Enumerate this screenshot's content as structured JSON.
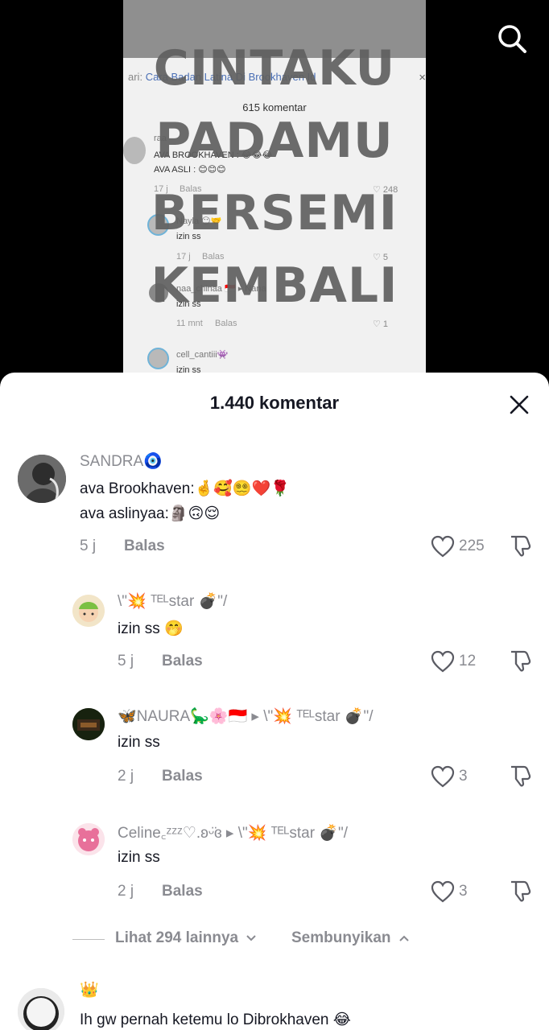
{
  "video": {
    "overlay_lines": [
      "CINTAKU",
      "PADAMU",
      "BERSEMI",
      "KEMBALI"
    ],
    "embedded": {
      "search_prefix": "ari:",
      "search_query": "Cara Badan Latina Di Brookhaven Id",
      "search_close": "×",
      "count": "615 komentar",
      "comments": [
        {
          "user": "raa",
          "lines": [
            "AVA BROOKHAVEN : 😂😂😂",
            "AVA ASLI : 😊😊😊"
          ],
          "time": "17 j",
          "reply": "Balas",
          "likes": "248"
        },
        {
          "user": "Nayla 😶🤝",
          "lines": [
            "izin ss"
          ],
          "time": "17 j",
          "reply": "Balas",
          "likes": "5"
        },
        {
          "user": "naa_chinaa 🇮🇩 ▸ Nana",
          "lines": [
            "izin ss"
          ],
          "time": "11 mnt",
          "reply": "Balas",
          "likes": "1"
        },
        {
          "user": "cell_cantiii👾",
          "lines": [
            "izin ss"
          ]
        }
      ]
    }
  },
  "sheet": {
    "title": "1.440 komentar",
    "comments": [
      {
        "user": "SANDRA🧿",
        "lines": [
          "ava Brookhaven:🤞🥰😵‍💫❤️🌹",
          "ava aslinyaa:🗿🙃😌"
        ],
        "time": "5 j",
        "reply": "Balas",
        "likes": "225"
      },
      {
        "user": "\\\"💥 ᵀᴱᴸstar 💣\"/",
        "lines": [
          "izin ss 🤭"
        ],
        "time": "5 j",
        "reply": "Balas",
        "likes": "12"
      },
      {
        "user": "🦋NAURA🦕🌸🇮🇩 ▸ \\\"💥 ᵀᴱᴸstar 💣\"/",
        "lines": [
          "izin ss"
        ],
        "time": "2 j",
        "reply": "Balas",
        "likes": "3"
      },
      {
        "user": "Celine꜀ᶻᶻᶻ♡.ʚᵕ̈ɞ ▸ \\\"💥 ᵀᴱᴸstar 💣\"/",
        "lines": [
          "izin ss"
        ],
        "time": "2 j",
        "reply": "Balas",
        "likes": "3"
      },
      {
        "user": "👑",
        "lines": [
          "Ih gw pernah ketemu lo Dibrokhaven 😂"
        ]
      }
    ],
    "view_more": "Lihat 294 lainnya",
    "hide": "Sembunyikan"
  },
  "colors": {
    "accent_gray": "#8a8b91",
    "text": "#161823",
    "sheet_bg": "#ffffff",
    "video_bg": "#000000"
  },
  "icons": [
    "search-icon",
    "close-icon",
    "heart-icon",
    "dislike-icon",
    "chevron-down-icon",
    "chevron-up-icon"
  ]
}
